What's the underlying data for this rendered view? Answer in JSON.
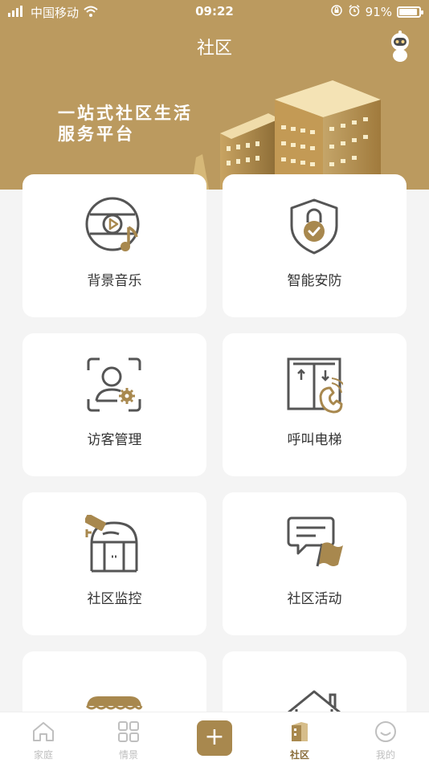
{
  "status": {
    "carrier": "中国移动",
    "time": "09:22",
    "battery": "91%",
    "battery_level": 0.91
  },
  "header": {
    "title": "社区",
    "slogan_line1": "一站式社区生活",
    "slogan_line2": "服务平台"
  },
  "services": [
    {
      "label": "背景音乐"
    },
    {
      "label": "智能安防"
    },
    {
      "label": "访客管理"
    },
    {
      "label": "呼叫电梯"
    },
    {
      "label": "社区监控"
    },
    {
      "label": "社区活动"
    }
  ],
  "tabs": [
    {
      "label": "家庭"
    },
    {
      "label": "情景"
    },
    {
      "label": "社区"
    },
    {
      "label": "我的"
    }
  ],
  "colors": {
    "brand": "#bb9a5f",
    "accent": "#a8884e",
    "icon_dark": "#555555"
  }
}
